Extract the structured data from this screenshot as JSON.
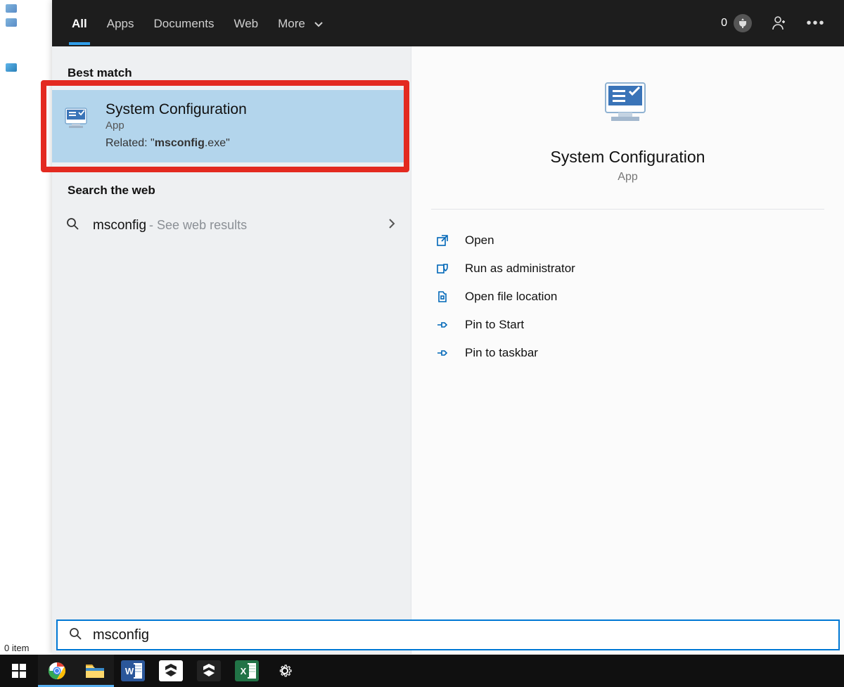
{
  "topBar": {
    "tabs": [
      "All",
      "Apps",
      "Documents",
      "Web",
      "More"
    ],
    "activeTab": 0,
    "rewardsNumber": "0"
  },
  "leftPane": {
    "bestMatchHeader": "Best match",
    "bestMatch": {
      "title": "System Configuration",
      "subtitle": "App",
      "relatedPrefix": "Related: \"",
      "relatedBold": "msconfig",
      "relatedSuffix": ".exe\""
    },
    "searchWebHeader": "Search the web",
    "webResult": {
      "query": "msconfig",
      "hint": " - See web results"
    }
  },
  "rightPane": {
    "title": "System Configuration",
    "subtitle": "App",
    "actions": [
      "Open",
      "Run as administrator",
      "Open file location",
      "Pin to Start",
      "Pin to taskbar"
    ]
  },
  "searchBox": {
    "value": "msconfig"
  },
  "statusBar": {
    "text": "0 item"
  },
  "taskbar": {
    "items": [
      "start",
      "chrome",
      "file-explorer",
      "word",
      "unity-white",
      "unity-dark",
      "excel",
      "settings"
    ]
  }
}
